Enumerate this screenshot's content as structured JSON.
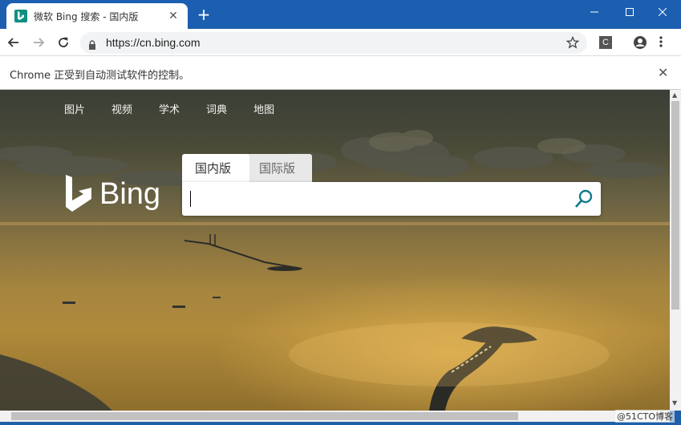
{
  "browser": {
    "tab_title": "微软 Bing 搜索 - 国内版",
    "url": "https://cn.bing.com",
    "extension_label": "C",
    "infobar_message": "Chrome 正受到自动测试软件的控制。"
  },
  "page": {
    "nav_links": [
      "图片",
      "视频",
      "学术",
      "词典",
      "地图"
    ],
    "logo_word": "Bing",
    "search_tabs": [
      "国内版",
      "国际版"
    ],
    "brand_color": "#008373"
  },
  "watermark": "@51CTO博客"
}
